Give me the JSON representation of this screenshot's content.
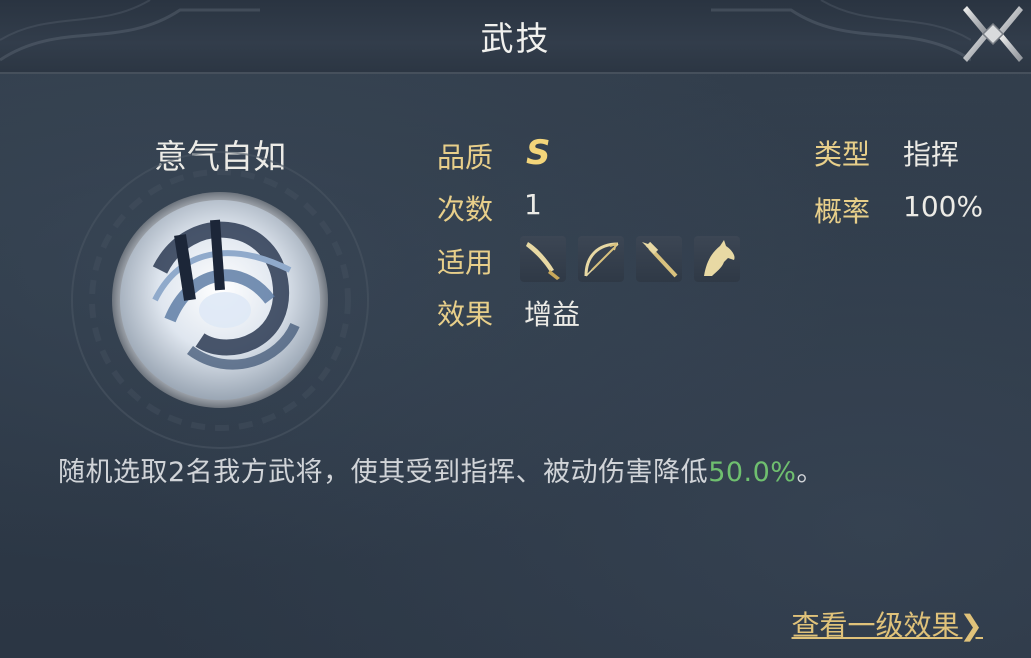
{
  "header": {
    "title": "武技"
  },
  "skill": {
    "name": "意气自如",
    "quality_label": "品质",
    "quality_value": "S",
    "count_label": "次数",
    "count_value": "1",
    "applicable_label": "适用",
    "applicable_icons": [
      "saber-icon",
      "bow-icon",
      "spear-icon",
      "horse-icon"
    ],
    "effect_label": "效果",
    "effect_value": "增益",
    "type_label": "类型",
    "type_value": "指挥",
    "rate_label": "概率",
    "rate_value": "100%"
  },
  "description": {
    "text_before": "随机选取2名我方武将，使其受到指挥、被动伤害降低",
    "highlight": "50.0%",
    "text_after": "。"
  },
  "footer": {
    "more_link": "查看一级效果",
    "more_arrow": "❯"
  },
  "colors": {
    "label": "#e8cf8a",
    "value": "#ecebe6",
    "highlight": "#6fbf6f",
    "link": "#e0c27a"
  }
}
